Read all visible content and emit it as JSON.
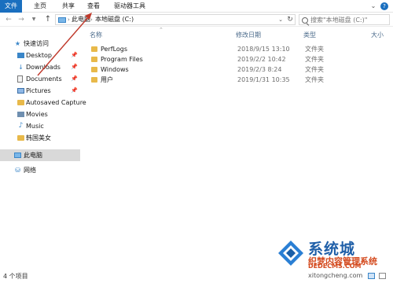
{
  "ribbon": {
    "tabs": [
      "文件",
      "主页",
      "共享",
      "查看",
      "驱动器工具"
    ]
  },
  "address": {
    "breadcrumbs": [
      "此电脑",
      "本地磁盘 (C:)"
    ],
    "search_placeholder": "搜索\"本地磁盘 (C:)\""
  },
  "nav": {
    "quick_access": "快速访问",
    "items": [
      "Desktop",
      "Downloads",
      "Documents",
      "Pictures",
      "Autosaved Capture",
      "Movies",
      "Music",
      "韩国美女"
    ],
    "this_pc": "此电脑",
    "network": "网络"
  },
  "columns": {
    "name": "名称",
    "date": "修改日期",
    "type": "类型",
    "size": "大小"
  },
  "files": [
    {
      "name": "PerfLogs",
      "date": "2018/9/15 13:10",
      "type": "文件夹"
    },
    {
      "name": "Program Files",
      "date": "2019/2/2 10:42",
      "type": "文件夹"
    },
    {
      "name": "Windows",
      "date": "2019/2/3 8:24",
      "type": "文件夹"
    },
    {
      "name": "用户",
      "date": "2019/1/31 10:35",
      "type": "文件夹"
    }
  ],
  "status": {
    "count": "4 个项目"
  },
  "watermark": {
    "line1": "系统城",
    "line2": "织梦内容管理系统",
    "line3": "DEDECMS.COM",
    "line4": "xitongcheng.com"
  },
  "colors": {
    "accent": "#1a6fbf",
    "folder": "#e8b94a",
    "annotation_arrow": "#c0392b"
  },
  "icons": {
    "back": "arrow-left-icon",
    "forward": "arrow-right-icon",
    "up": "arrow-up-icon",
    "search": "search-icon",
    "folder": "folder-icon"
  }
}
